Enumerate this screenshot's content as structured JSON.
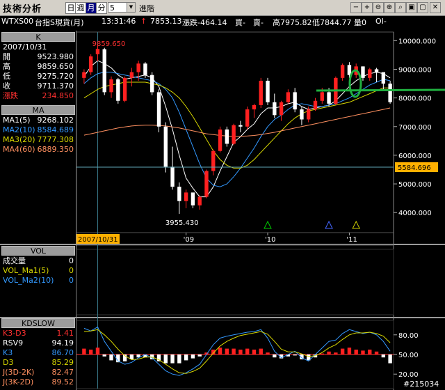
{
  "toolbar": {
    "title": "技術分析",
    "day_label": "日",
    "week_label": "週",
    "month_label": "月",
    "minute_label": "分",
    "period_value": "5",
    "advance_label": "進階",
    "tools": [
      "−",
      "+",
      "⊖",
      "⊕",
      "⌕",
      "▣",
      "▢",
      "✕"
    ]
  },
  "infobar": {
    "symbol": "WTXS00",
    "name": "台指S現貨(月)",
    "time": "13:31:46",
    "arrow": "↑",
    "price": "7853.13",
    "change": "漲跌-464.14",
    "buy": "買-",
    "sell": "賣-",
    "high": "高7975.82",
    "low": "低7844.77",
    "volume": "量0",
    "open_interest": "OI-"
  },
  "k_panel": {
    "header": "K",
    "date": "2007/10/31",
    "rows": [
      {
        "label": "開",
        "value": "9523.980",
        "color": "#ffffff"
      },
      {
        "label": "高",
        "value": "9859.650",
        "color": "#ffffff"
      },
      {
        "label": "低",
        "value": "9275.720",
        "color": "#ffffff"
      },
      {
        "label": "收",
        "value": "9711.370",
        "color": "#ffffff"
      },
      {
        "label": "漲跌",
        "value": "234.850",
        "color": "#ff3030"
      }
    ]
  },
  "ma_panel": {
    "header": "MA",
    "rows": [
      {
        "label": "MA1(5)",
        "value": "9268.102",
        "color": "#ffffff"
      },
      {
        "label": "MA2(10)",
        "value": "8584.689",
        "color": "#3399ff"
      },
      {
        "label": "MA3(20)",
        "value": "7777.308",
        "color": "#d8d800"
      },
      {
        "label": "MA4(60)",
        "value": "6889.350",
        "color": "#ff9060"
      }
    ]
  },
  "vol_panel": {
    "header": "VOL",
    "rows": [
      {
        "label": "成交量",
        "value": "0",
        "color": "#ffffff"
      },
      {
        "label": "VOL_Ma1(5)",
        "value": "0",
        "color": "#d8d800"
      },
      {
        "label": "VOL_Ma2(10)",
        "value": "0",
        "color": "#3399ff"
      }
    ]
  },
  "kd_panel": {
    "header": "KDSLOW",
    "rows": [
      {
        "label": "K3-D3",
        "value": "1.41",
        "color": "#ff3030"
      },
      {
        "label": "RSV9",
        "value": "94.19",
        "color": "#ffffff"
      },
      {
        "label": "K3",
        "value": "86.70",
        "color": "#3399ff"
      },
      {
        "label": "D3",
        "value": "85.29",
        "color": "#d8d800"
      },
      {
        "label": "J(3D-2K)",
        "value": "82.47",
        "color": "#ff9060"
      },
      {
        "label": "J(3K-2D)",
        "value": "89.52",
        "color": "#ff9060"
      }
    ]
  },
  "chart_data": {
    "type": "candlestick",
    "y_ticks": [
      "10000.000",
      "9000.000",
      "8000.000",
      "7000.000",
      "6000.000",
      "5000.000",
      "4000.000"
    ],
    "y_min": 3300,
    "y_max": 10300,
    "x_labels": [
      {
        "idx": 0,
        "label": "2007/10/31"
      },
      {
        "idx": 15,
        "label": "'09"
      },
      {
        "idx": 27,
        "label": "'10"
      },
      {
        "idx": 39,
        "label": "'11"
      }
    ],
    "high_label": "9859.650",
    "low_label": "3955.430",
    "hline_value": 5584.696,
    "hline_label": "5584.696",
    "kd_ticks": [
      "80.00",
      "50.00",
      "20.00"
    ],
    "candles": [
      [
        8700,
        9000,
        8500,
        8900
      ],
      [
        8900,
        9524,
        8800,
        9450
      ],
      [
        9524,
        9860,
        9276,
        9711
      ],
      [
        9700,
        9750,
        8100,
        8200
      ],
      [
        8200,
        8750,
        8000,
        8650
      ],
      [
        8650,
        8700,
        7800,
        7900
      ],
      [
        7900,
        8750,
        7850,
        8700
      ],
      [
        8700,
        9050,
        8400,
        8900
      ],
      [
        8900,
        9300,
        8600,
        9200
      ],
      [
        9200,
        9250,
        8700,
        8800
      ],
      [
        8800,
        8900,
        8100,
        8200
      ],
      [
        8200,
        8300,
        6800,
        7000
      ],
      [
        7000,
        7150,
        5400,
        5600
      ],
      [
        5600,
        6300,
        4800,
        4900
      ],
      [
        4900,
        5050,
        3955,
        4400
      ],
      [
        4400,
        4800,
        4150,
        4700
      ],
      [
        4700,
        4650,
        4150,
        4250
      ],
      [
        4250,
        4600,
        4100,
        4550
      ],
      [
        4550,
        5500,
        4500,
        5450
      ],
      [
        5450,
        6200,
        5300,
        6150
      ],
      [
        6150,
        7000,
        6100,
        6900
      ],
      [
        6900,
        7000,
        6300,
        6400
      ],
      [
        6400,
        7100,
        6350,
        7050
      ],
      [
        7050,
        7200,
        6800,
        7000
      ],
      [
        7000,
        7700,
        6900,
        7600
      ],
      [
        7600,
        7800,
        7300,
        7750
      ],
      [
        7750,
        8700,
        7650,
        8600
      ],
      [
        8600,
        8700,
        7750,
        7850
      ],
      [
        7850,
        8150,
        7300,
        7400
      ],
      [
        7400,
        7900,
        7200,
        7850
      ],
      [
        7850,
        8300,
        7800,
        8200
      ],
      [
        8200,
        8350,
        7500,
        7600
      ],
      [
        7600,
        7700,
        7050,
        7250
      ],
      [
        7250,
        7700,
        7150,
        7600
      ],
      [
        7600,
        8000,
        7550,
        7900
      ],
      [
        7900,
        8350,
        7800,
        8200
      ],
      [
        8200,
        8350,
        7700,
        7800
      ],
      [
        7800,
        8750,
        7750,
        8700
      ],
      [
        8700,
        9200,
        8600,
        9150
      ],
      [
        9150,
        9250,
        8700,
        8800
      ],
      [
        8800,
        9200,
        8700,
        9100
      ],
      [
        9100,
        9100,
        8600,
        8700
      ],
      [
        8700,
        9050,
        8600,
        9000
      ],
      [
        9000,
        9050,
        8550,
        8900
      ],
      [
        8900,
        8700,
        8300,
        8500
      ],
      [
        8500,
        8600,
        7800,
        7853
      ]
    ],
    "ma_series": [
      {
        "name": "MA1(5)",
        "color": "#ffffff",
        "values": [
          8750,
          9100,
          9300,
          9200,
          9050,
          8800,
          8650,
          8700,
          8750,
          8800,
          8700,
          8400,
          7700,
          6900,
          6000,
          5200,
          4850,
          4550,
          4550,
          4900,
          5450,
          5950,
          6450,
          6650,
          6900,
          7100,
          7450,
          7650,
          7650,
          7700,
          7800,
          7850,
          7700,
          7600,
          7650,
          7700,
          7750,
          7900,
          8150,
          8400,
          8600,
          8750,
          8850,
          8900,
          8850,
          8700
        ]
      },
      {
        "name": "MA2(10)",
        "color": "#3399ff",
        "values": [
          8500,
          8700,
          8850,
          8900,
          8900,
          8850,
          8800,
          8750,
          8700,
          8650,
          8600,
          8500,
          8300,
          8000,
          7500,
          6900,
          6300,
          5700,
          5200,
          4950,
          4900,
          5000,
          5250,
          5550,
          5900,
          6250,
          6650,
          7000,
          7250,
          7400,
          7600,
          7750,
          7800,
          7750,
          7700,
          7700,
          7750,
          7800,
          7900,
          8000,
          8150,
          8300,
          8450,
          8550,
          8650,
          8600
        ]
      },
      {
        "name": "MA3(20)",
        "color": "#d8d800",
        "values": [
          8000,
          8150,
          8300,
          8400,
          8450,
          8500,
          8550,
          8550,
          8550,
          8550,
          8500,
          8450,
          8350,
          8200,
          8000,
          7700,
          7350,
          6950,
          6550,
          6150,
          5850,
          5650,
          5550,
          5550,
          5650,
          5850,
          6100,
          6350,
          6600,
          6850,
          7100,
          7300,
          7450,
          7550,
          7600,
          7650,
          7700,
          7750,
          7800,
          7850,
          7950,
          8050,
          8150,
          8250,
          8350,
          8350
        ]
      },
      {
        "name": "MA4(60)",
        "color": "#ff9060",
        "values": [
          6700,
          6750,
          6800,
          6850,
          6900,
          6950,
          6990,
          7020,
          7040,
          7050,
          7050,
          7040,
          7020,
          6990,
          6950,
          6900,
          6850,
          6800,
          6750,
          6720,
          6690,
          6670,
          6660,
          6660,
          6670,
          6690,
          6720,
          6760,
          6800,
          6850,
          6900,
          6950,
          7000,
          7050,
          7100,
          7150,
          7200,
          7250,
          7300,
          7350,
          7400,
          7450,
          7500,
          7550,
          7600,
          7650
        ]
      }
    ],
    "kd_bars": [
      0.6,
      0.5,
      0.7,
      -0.2,
      -0.6,
      -0.8,
      -0.7,
      -0.5,
      -0.3,
      -0.3,
      -0.5,
      -0.7,
      -0.9,
      -0.9,
      -0.9,
      -0.6,
      -0.4,
      -0.2,
      0.2,
      0.5,
      0.7,
      0.6,
      0.6,
      0.5,
      0.6,
      0.5,
      0.6,
      0.2,
      -0.3,
      -0.4,
      -0.2,
      -0.1,
      -0.5,
      -0.6,
      -0.3,
      0.1,
      0.3,
      0.2,
      0.6,
      0.7,
      0.5,
      0.4,
      0.5,
      0.3,
      -0.3,
      -0.9
    ],
    "k_series": [
      90,
      86,
      92,
      70,
      55,
      40,
      35,
      38,
      45,
      50,
      45,
      35,
      25,
      20,
      18,
      22,
      28,
      35,
      50,
      65,
      75,
      78,
      80,
      82,
      84,
      85,
      88,
      75,
      55,
      45,
      50,
      55,
      45,
      40,
      50,
      60,
      70,
      72,
      82,
      88,
      85,
      82,
      84,
      80,
      70,
      55
    ],
    "d_series": [
      85,
      86,
      88,
      80,
      70,
      58,
      48,
      42,
      43,
      46,
      46,
      42,
      35,
      28,
      22,
      21,
      24,
      29,
      40,
      52,
      63,
      70,
      75,
      79,
      81,
      83,
      85,
      81,
      70,
      58,
      54,
      54,
      51,
      47,
      48,
      53,
      60,
      65,
      73,
      80,
      83,
      83,
      84,
      82,
      78,
      68
    ],
    "markers": [
      {
        "idx": 27,
        "color": "#00cc00"
      },
      {
        "idx": 36,
        "color": "#4466ff"
      },
      {
        "idx": 40,
        "color": "#cccc00"
      }
    ]
  },
  "watermark": "#215034"
}
